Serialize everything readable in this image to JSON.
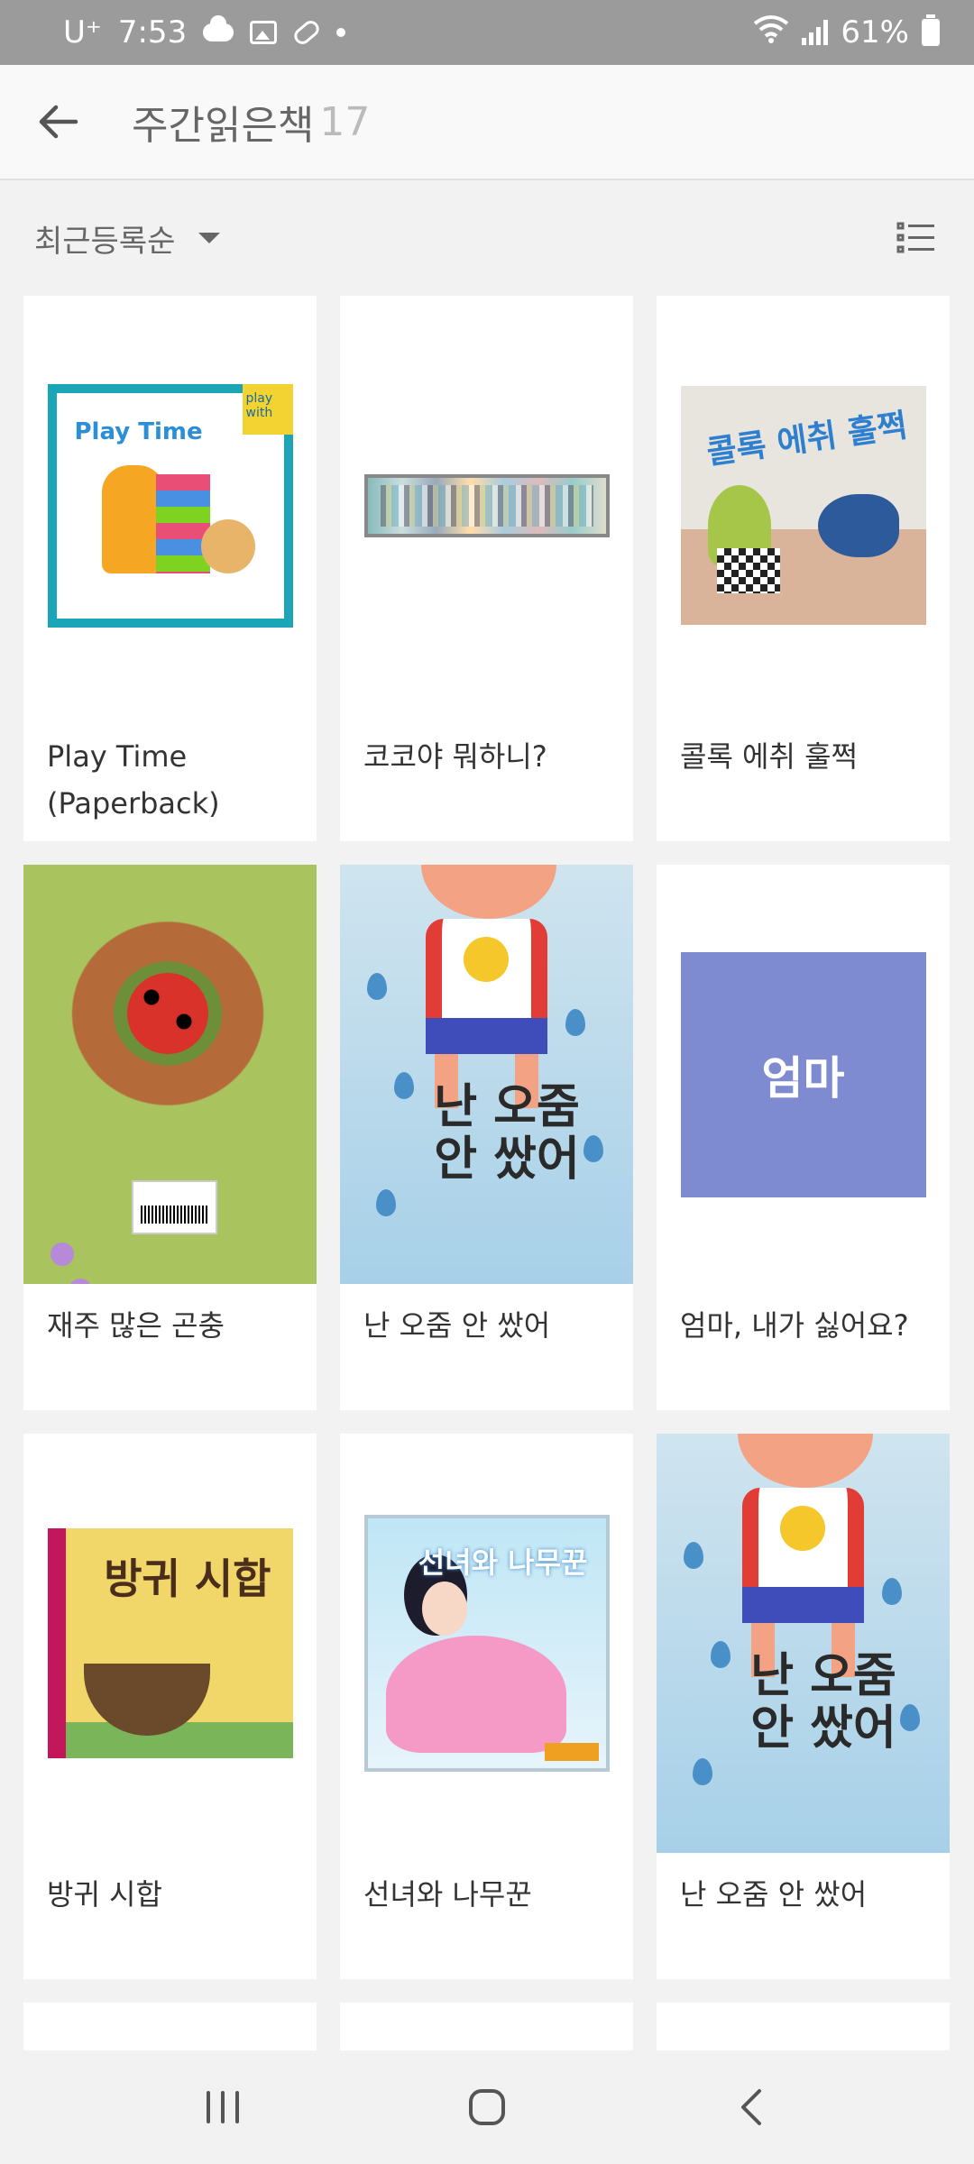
{
  "status_bar": {
    "carrier": "U⁺",
    "time": "7:53",
    "battery": "61%",
    "icons": [
      "cloud-icon",
      "gallery-icon",
      "pill-icon",
      "dot-icon",
      "wifi-icon",
      "signal-icon",
      "battery-icon"
    ]
  },
  "app_bar": {
    "title": "주간읽은책",
    "count": "17",
    "back_icon": "arrow-left-icon"
  },
  "sort_bar": {
    "sort_label": "최근등록순",
    "view_toggle_icon": "list-view-icon"
  },
  "books": [
    {
      "title": "Play Time (Paperback)",
      "cover_text": "Play Time",
      "cover_tag": "play with"
    },
    {
      "title": "코코야 뭐하니?"
    },
    {
      "title": "콜록 에취 훌쩍",
      "cover_text": "콜록 에취 훌쩍"
    },
    {
      "title": "재주 많은 곤충"
    },
    {
      "title": "난 오줌 안 쌌어",
      "cover_text": "난 오줌 안 쌌어"
    },
    {
      "title": "엄마, 내가 싫어요?",
      "cover_text": "엄마"
    },
    {
      "title": "방귀 시합",
      "cover_text": "방귀 시합"
    },
    {
      "title": "선녀와 나무꾼",
      "cover_text": "선녀와 나무꾼"
    },
    {
      "title": "난 오줌 안 쌌어",
      "cover_text": "난 오줌 안 쌌어"
    }
  ],
  "bottom_nav": {
    "icons": [
      "recents-icon",
      "home-icon",
      "back-icon"
    ]
  },
  "colors": {
    "status_bar_bg": "#9b9b9b",
    "app_bar_bg": "#f9f9f9",
    "page_bg": "#f2f2f2",
    "card_bg": "#ffffff",
    "placeholder_cover": "#7f8bd0"
  }
}
